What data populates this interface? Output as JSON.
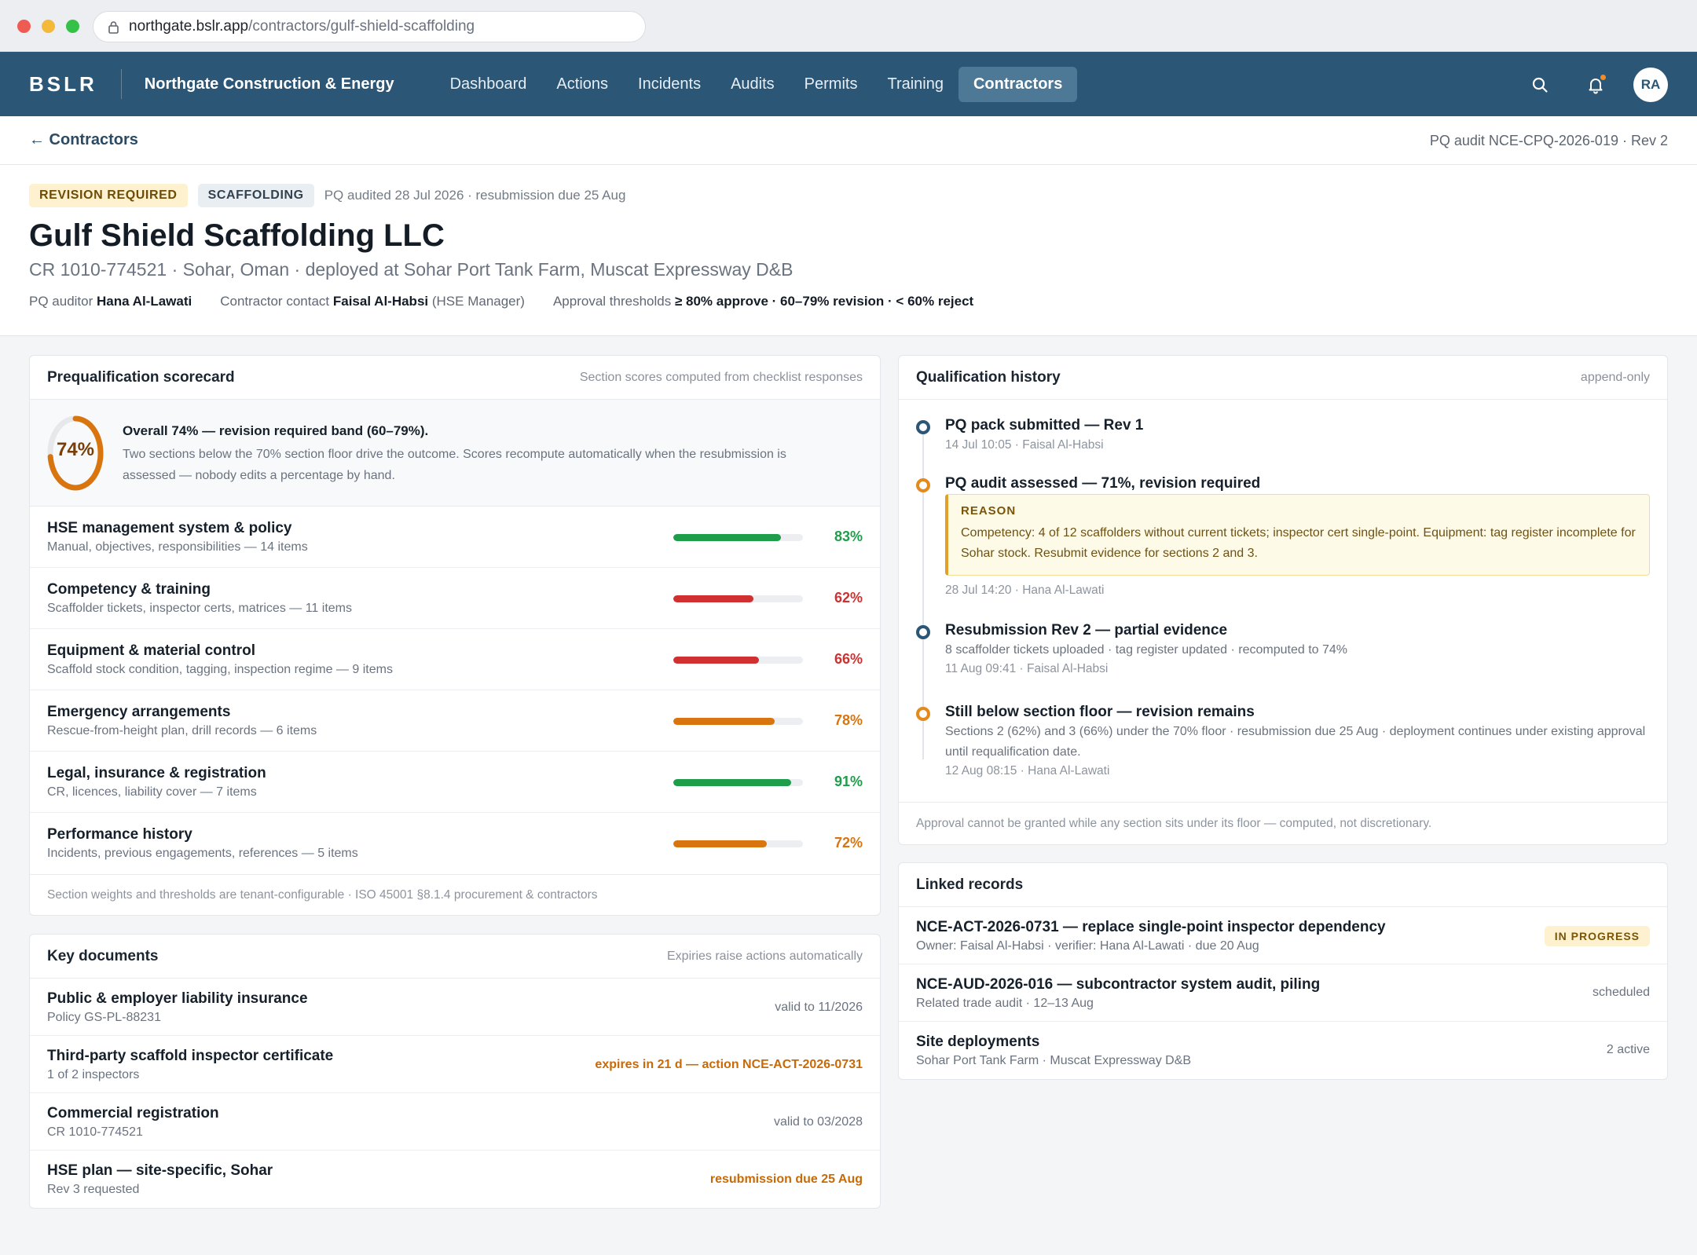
{
  "browser": {
    "url_host": "northgate.bslr.app",
    "url_path": "/contractors/gulf-shield-scaffolding"
  },
  "nav": {
    "brand": "BSLR",
    "org": "Northgate Construction & Energy",
    "items": [
      "Dashboard",
      "Actions",
      "Incidents",
      "Audits",
      "Permits",
      "Training",
      "Contractors"
    ],
    "active": "Contractors",
    "avatar": "RA",
    "notification_dot_color": "#f28c28"
  },
  "breadcrumb": {
    "back_label": "← Contractors",
    "audit_ref": "PQ audit NCE-CPQ-2026-019 · Rev 2"
  },
  "header": {
    "status_badge": "REVISION REQUIRED",
    "trade_badge": "SCAFFOLDING",
    "audit_meta": "PQ audited 28 Jul 2026 · resubmission due 25 Aug",
    "title": "Gulf Shield Scaffolding LLC",
    "subtitle": "CR 1010-774521 · Sohar, Oman · deployed at Sohar Port Tank Farm, Muscat Expressway D&B",
    "auditor_label": "PQ auditor",
    "auditor_name": "Hana Al-Lawati",
    "contact_label": "Contractor contact",
    "contact_name": "Faisal Al-Habsi",
    "contact_role": "(HSE Manager)",
    "thresholds_label": "Approval thresholds",
    "thresholds_value": "≥ 80% approve · 60–79% revision · < 60% reject"
  },
  "scorecard": {
    "title": "Prequalification scorecard",
    "note": "Section scores computed from checklist responses",
    "overall_pct": 74,
    "overall_label": "74%",
    "overall_head": "Overall 74% — revision required band (60–79%).",
    "overall_body": "Two sections below the 70% section floor drive the outcome. Scores recompute automatically when the resubmission is assessed — nobody edits a percentage by hand.",
    "sections": [
      {
        "name": "HSE management system & policy",
        "sub": "Manual, objectives, responsibilities — 14 items",
        "pct": 83,
        "label": "83%",
        "color": "#1e9e4a"
      },
      {
        "name": "Competency & training",
        "sub": "Scaffolder tickets, inspector certs, matrices — 11 items",
        "pct": 62,
        "label": "62%",
        "color": "#d0302f"
      },
      {
        "name": "Equipment & material control",
        "sub": "Scaffold stock condition, tagging, inspection regime — 9 items",
        "pct": 66,
        "label": "66%",
        "color": "#d0302f"
      },
      {
        "name": "Emergency arrangements",
        "sub": "Rescue-from-height plan, drill records — 6 items",
        "pct": 78,
        "label": "78%",
        "color": "#d9750f"
      },
      {
        "name": "Legal, insurance & registration",
        "sub": "CR, licences, liability cover — 7 items",
        "pct": 91,
        "label": "91%",
        "color": "#1e9e4a"
      },
      {
        "name": "Performance history",
        "sub": "Incidents, previous engagements, references — 5 items",
        "pct": 72,
        "label": "72%",
        "color": "#d9750f"
      }
    ],
    "footer": "Section weights and thresholds are tenant-configurable · ISO 45001 §8.1.4 procurement & contractors",
    "ring_color": "#d9750f"
  },
  "documents": {
    "title": "Key documents",
    "note": "Expiries raise actions automatically",
    "items": [
      {
        "name": "Public & employer liability insurance",
        "sub": "Policy GS-PL-88231",
        "status": "valid to 11/2026",
        "warn": false
      },
      {
        "name": "Third-party scaffold inspector certificate",
        "sub": "1 of 2 inspectors",
        "status": "expires in 21 d — action NCE-ACT-2026-0731",
        "warn": true
      },
      {
        "name": "Commercial registration",
        "sub": "CR 1010-774521",
        "status": "valid to 03/2028",
        "warn": false
      },
      {
        "name": "HSE plan — site-specific, Sohar",
        "sub": "Rev 3 requested",
        "status": "resubmission due 25 Aug",
        "warn": true
      }
    ]
  },
  "history": {
    "title": "Qualification history",
    "note": "append-only",
    "items": [
      {
        "title": "PQ pack submitted — Rev 1",
        "meta": "14 Jul 10:05 · Faisal Al-Habsi"
      },
      {
        "title": "PQ audit assessed — 71%, revision required",
        "reason_label": "REASON",
        "reason_text": "Competency: 4 of 12 scaffolders without current tickets; inspector cert single-point. Equipment: tag register incomplete for Sohar stock. Resubmit evidence for sections 2 and 3.",
        "meta": "28 Jul 14:20 · Hana Al-Lawati"
      },
      {
        "title": "Resubmission Rev 2 — partial evidence",
        "text": "8 scaffolder tickets uploaded · tag register updated · recomputed to 74%",
        "meta": "11 Aug 09:41 · Faisal Al-Habsi"
      },
      {
        "title": "Still below section floor — revision remains",
        "text": "Sections 2 (62%) and 3 (66%) under the 70% floor · resubmission due 25 Aug · deployment continues under existing approval until requalification date.",
        "meta": "12 Aug 08:15 · Hana Al-Lawati"
      }
    ],
    "footer": "Approval cannot be granted while any section sits under its floor — computed, not discretionary."
  },
  "linked": {
    "title": "Linked records",
    "items": [
      {
        "name": "NCE-ACT-2026-0731 — replace single-point inspector dependency",
        "sub": "Owner: Faisal Al-Habsi · verifier: Hana Al-Lawati · due 20 Aug",
        "status": "IN PROGRESS",
        "pill": true
      },
      {
        "name": "NCE-AUD-2026-016 — subcontractor system audit, piling",
        "sub": "Related trade audit · 12–13 Aug",
        "status": "scheduled",
        "pill": false
      },
      {
        "name": "Site deployments",
        "sub": "Sohar Port Tank Farm · Muscat Expressway D&B",
        "status": "2 active",
        "pill": false
      }
    ]
  }
}
